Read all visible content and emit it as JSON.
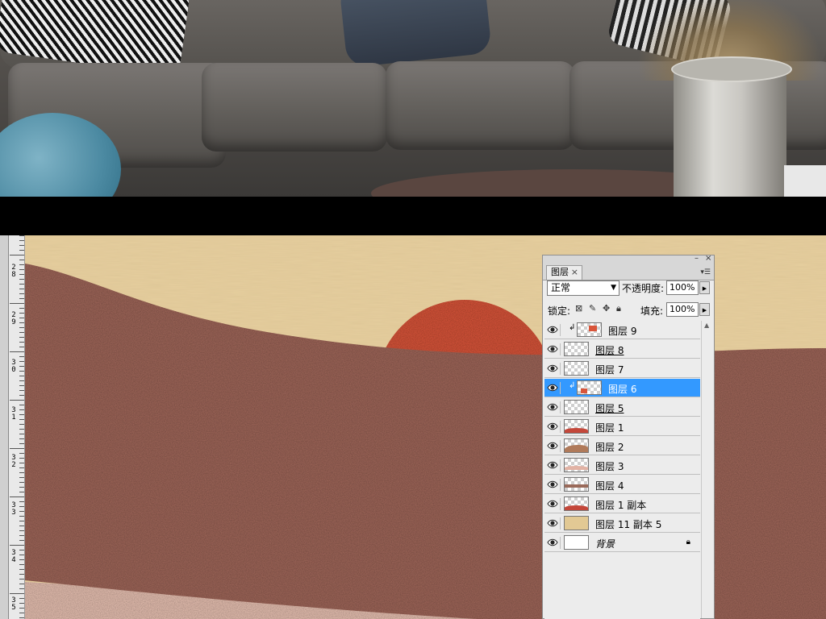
{
  "panel": {
    "tab_label": "图层",
    "tab_close": "×",
    "window_controls": {
      "minimize": "–",
      "close": "×"
    },
    "menu_icon": "▾☰",
    "blend_mode": "正常",
    "opacity_label": "不透明度:",
    "opacity_value": "100%",
    "lock_label": "锁定:",
    "lock_icons": [
      "lock-transparent-icon",
      "lock-brush-icon",
      "lock-move-icon",
      "lock-all-icon"
    ],
    "fill_label": "填充:",
    "fill_value": "100%",
    "layers": [
      {
        "name": "图层 9",
        "clipped": true,
        "selected": false,
        "underline": false,
        "thumb": "orange-square"
      },
      {
        "name": "图层 8",
        "clipped": false,
        "selected": false,
        "underline": true,
        "thumb": "empty"
      },
      {
        "name": "图层 7",
        "clipped": false,
        "selected": false,
        "underline": false,
        "thumb": "empty"
      },
      {
        "name": "图层 6",
        "clipped": true,
        "selected": true,
        "underline": false,
        "thumb": "orange-small"
      },
      {
        "name": "图层 5",
        "clipped": false,
        "selected": false,
        "underline": true,
        "thumb": "empty"
      },
      {
        "name": "图层 1",
        "clipped": false,
        "selected": false,
        "underline": false,
        "thumb": "red-hills"
      },
      {
        "name": "图层 2",
        "clipped": false,
        "selected": false,
        "underline": false,
        "thumb": "brown-hills"
      },
      {
        "name": "图层 3",
        "clipped": false,
        "selected": false,
        "underline": false,
        "thumb": "pink-hills"
      },
      {
        "name": "图层 4",
        "clipped": false,
        "selected": false,
        "underline": false,
        "thumb": "brown-band"
      },
      {
        "name": "图层 1 副本",
        "clipped": false,
        "selected": false,
        "underline": false,
        "thumb": "red-hills"
      },
      {
        "name": "图层 11 副本 5",
        "clipped": false,
        "selected": false,
        "underline": false,
        "thumb": "sand"
      },
      {
        "name": "背景",
        "clipped": false,
        "selected": false,
        "underline": false,
        "italic": true,
        "locked": true,
        "thumb": "white"
      }
    ]
  },
  "ruler": {
    "labels": [
      [
        "2",
        "8"
      ],
      [
        "2",
        "9"
      ],
      [
        "3",
        "0"
      ],
      [
        "3",
        "1"
      ],
      [
        "3",
        "2"
      ],
      [
        "3",
        "3"
      ],
      [
        "3",
        "4"
      ],
      [
        "3",
        "5"
      ]
    ]
  },
  "colors": {
    "selection": "#3399ff",
    "sand": "#e6cf9f",
    "brown_hill": "#a0675a",
    "sun": "#d9553a",
    "pink_hill": "#e8c1b2"
  }
}
